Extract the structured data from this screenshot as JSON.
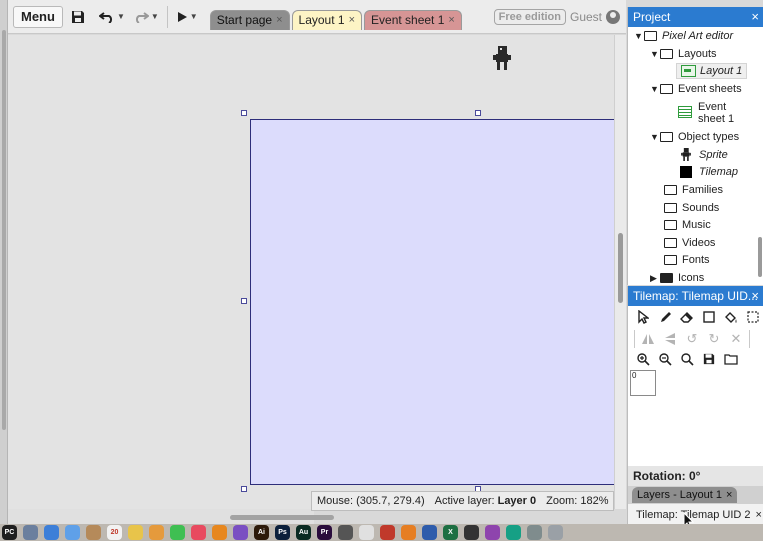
{
  "toolbar": {
    "menu_label": "Menu",
    "tabs": [
      {
        "label": "Start page",
        "close": "×"
      },
      {
        "label": "Layout 1",
        "close": "×"
      },
      {
        "label": "Event sheet 1",
        "close": "×"
      }
    ],
    "edition_badge": "Free edition",
    "user_label": "Guest"
  },
  "status": {
    "mouse": "Mouse: (305.7, 279.4)",
    "active_layer_prefix": "Active layer: ",
    "active_layer_value": "Layer 0",
    "zoom": "Zoom: 182%"
  },
  "project": {
    "title": "Project",
    "close": "×",
    "tree": {
      "root": "Pixel Art editor",
      "layouts": "Layouts",
      "layout_1": "Layout 1",
      "event_sheets": "Event sheets",
      "event_sheet_1_line1": "Event",
      "event_sheet_1_line2": "sheet 1",
      "object_types": "Object types",
      "sprite": "Sprite",
      "tilemap": "Tilemap",
      "families": "Families",
      "sounds": "Sounds",
      "music": "Music",
      "videos": "Videos",
      "fonts": "Fonts",
      "icons": "Icons"
    }
  },
  "tilemap_panel": {
    "title": "Tilemap: Tilemap UID...",
    "close": "×",
    "tile_index": "0"
  },
  "properties": {
    "rotation": "Rotation: 0°"
  },
  "bottom_tabs": {
    "layers": "Layers - Layout 1",
    "layers_close": "×",
    "tilemap": "Tilemap: Tilemap UID 2",
    "tilemap_close": "×"
  },
  "dock": {
    "first_app_label": "PC",
    "apps": [
      {
        "name": "pycharm",
        "color": "#1f1f1f",
        "text": "PC"
      },
      {
        "name": "launchpad",
        "color": "#6b7f9e",
        "text": ""
      },
      {
        "name": "finder",
        "color": "#3d7fd8",
        "text": ""
      },
      {
        "name": "mail",
        "color": "#5fa0e8",
        "text": ""
      },
      {
        "name": "contacts",
        "color": "#b58a5a",
        "text": ""
      },
      {
        "name": "calendar",
        "color": "#f2f2f2",
        "text": "20"
      },
      {
        "name": "notes",
        "color": "#e8c44a",
        "text": ""
      },
      {
        "name": "photos",
        "color": "#e59a3c",
        "text": ""
      },
      {
        "name": "messages",
        "color": "#3fbf52",
        "text": ""
      },
      {
        "name": "music",
        "color": "#e84a5f",
        "text": ""
      },
      {
        "name": "vlc",
        "color": "#e7871e",
        "text": ""
      },
      {
        "name": "affinity",
        "color": "#7a4fc2",
        "text": ""
      },
      {
        "name": "illustrator",
        "color": "#2d1a0a",
        "text": "Ai"
      },
      {
        "name": "photoshop",
        "color": "#0b1f3b",
        "text": "Ps"
      },
      {
        "name": "audition",
        "color": "#0a2b22",
        "text": "Au"
      },
      {
        "name": "premiere",
        "color": "#2a0c3c",
        "text": "Pr"
      },
      {
        "name": "headphones",
        "color": "#555555",
        "text": ""
      },
      {
        "name": "chrome",
        "color": "#e0e0e0",
        "text": ""
      },
      {
        "name": "app-red",
        "color": "#c0392b",
        "text": ""
      },
      {
        "name": "app-orange",
        "color": "#e67e22",
        "text": ""
      },
      {
        "name": "app-blue",
        "color": "#2e5cab",
        "text": ""
      },
      {
        "name": "excel",
        "color": "#1d6f42",
        "text": "X"
      },
      {
        "name": "app-dark",
        "color": "#333333",
        "text": ""
      },
      {
        "name": "app-purple",
        "color": "#8e44ad",
        "text": ""
      },
      {
        "name": "app-teal",
        "color": "#16a085",
        "text": ""
      },
      {
        "name": "app-grey",
        "color": "#7f8c8d",
        "text": ""
      },
      {
        "name": "trash",
        "color": "#9aa0a6",
        "text": ""
      }
    ]
  },
  "colors": {
    "panel_header": "#2b7bd0",
    "layout_fill": "#dcdcfc",
    "layout_tab": "#fdf4c5",
    "event_tab": "#d69595"
  }
}
